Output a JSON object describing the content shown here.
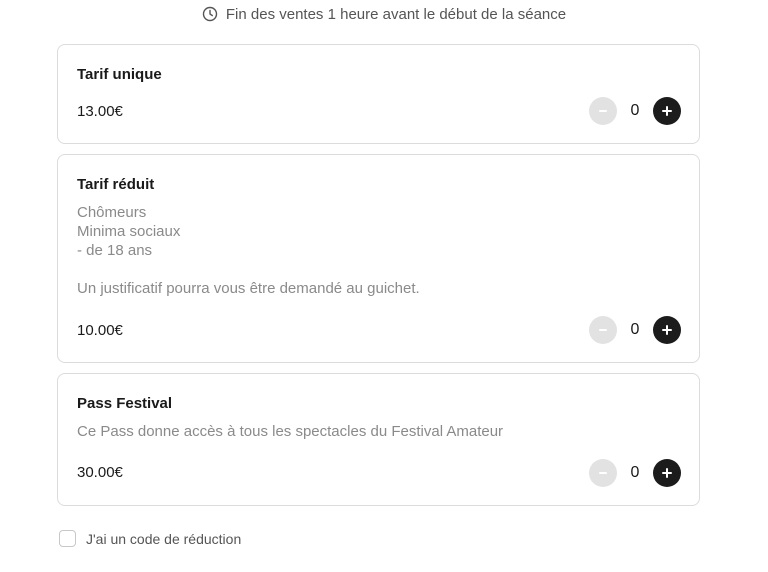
{
  "notice": {
    "icon": "clock-icon",
    "text": "Fin des ventes 1 heure avant le début de la séance"
  },
  "tickets": [
    {
      "title": "Tarif unique",
      "description": "",
      "price": "13.00€",
      "quantity": "0"
    },
    {
      "title": "Tarif réduit",
      "description": "Chômeurs\nMinima sociaux\n- de 18 ans\n\nUn justificatif pourra vous être demandé au guichet.",
      "price": "10.00€",
      "quantity": "0"
    },
    {
      "title": "Pass Festival",
      "description": "Ce Pass donne accès à tous les spectacles du Festival Amateur",
      "price": "30.00€",
      "quantity": "0"
    }
  ],
  "discount": {
    "label": "J'ai un code de réduction",
    "checked": false
  },
  "colors": {
    "plus_button": "#1c1c1c",
    "minus_button_disabled": "#e2e2e2",
    "card_border": "#dcdcdc"
  }
}
